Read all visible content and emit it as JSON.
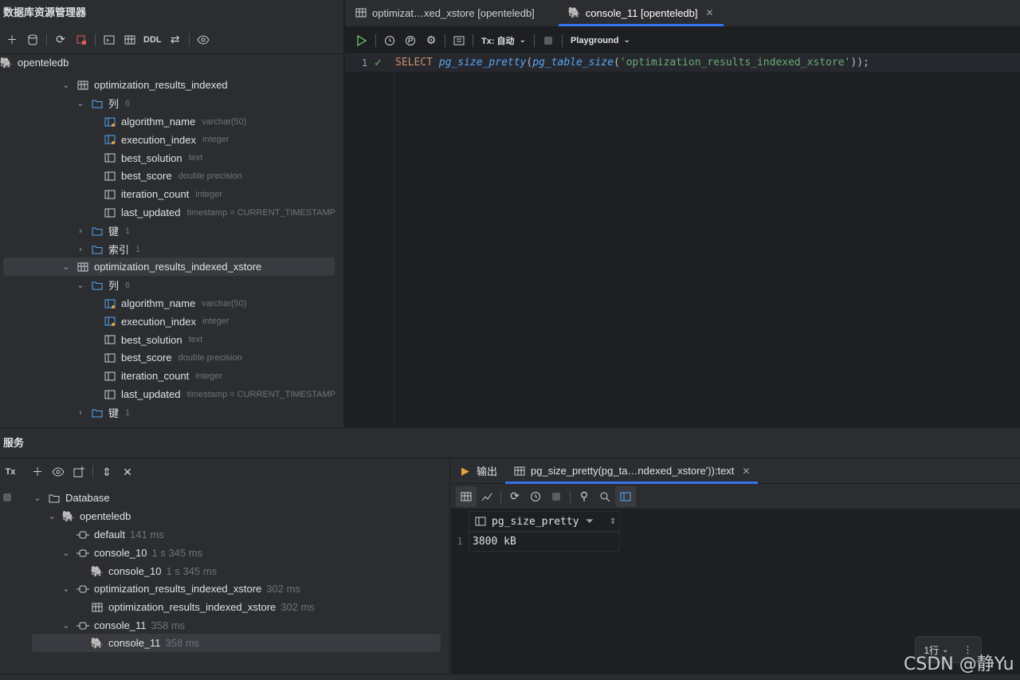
{
  "db_explorer": {
    "title": "数据库资源管理器",
    "toolbar_ddl": "DDL",
    "root": "openteledb",
    "tables": [
      {
        "name": "optimization_results_indexed",
        "columns_label": "列",
        "columns_count": "6",
        "columns": [
          {
            "name": "algorithm_name",
            "type": "varchar(50)"
          },
          {
            "name": "execution_index",
            "type": "integer"
          },
          {
            "name": "best_solution",
            "type": "text"
          },
          {
            "name": "best_score",
            "type": "double precision"
          },
          {
            "name": "iteration_count",
            "type": "integer"
          },
          {
            "name": "last_updated",
            "type": "timestamp = CURRENT_TIMESTAMP"
          }
        ],
        "keys_label": "键",
        "keys_count": "1",
        "indexes_label": "索引",
        "indexes_count": "1"
      },
      {
        "name": "optimization_results_indexed_xstore",
        "columns_label": "列",
        "columns_count": "6",
        "columns": [
          {
            "name": "algorithm_name",
            "type": "varchar(50)"
          },
          {
            "name": "execution_index",
            "type": "integer"
          },
          {
            "name": "best_solution",
            "type": "text"
          },
          {
            "name": "best_score",
            "type": "double precision"
          },
          {
            "name": "iteration_count",
            "type": "integer"
          },
          {
            "name": "last_updated",
            "type": "timestamp = CURRENT_TIMESTAMP"
          }
        ],
        "keys_label": "键",
        "keys_count": "1"
      }
    ]
  },
  "editor": {
    "tabs": [
      {
        "label": "optimizat…xed_xstore [openteledb]"
      },
      {
        "label": "console_11 [openteledb]"
      }
    ],
    "tx_label": "Tx: 自动",
    "playground_label": "Playground",
    "line_number": "1",
    "code": {
      "select": "SELECT",
      "fn1": "pg_size_pretty",
      "open1": "(",
      "fn2": "pg_table_size",
      "open2": "(",
      "str": "'optimization_results_indexed_xstore'",
      "close": "));"
    }
  },
  "services": {
    "title": "服务",
    "tx_label": "Tx",
    "tree": {
      "database": "Database",
      "connection": "openteledb",
      "sessions": [
        {
          "name": "default",
          "time": "141 ms"
        },
        {
          "name": "console_10",
          "time": "1 s 345 ms",
          "child": {
            "name": "console_10",
            "time": "1 s 345 ms"
          }
        },
        {
          "name": "optimization_results_indexed_xstore",
          "time": "302 ms",
          "child": {
            "name": "optimization_results_indexed_xstore",
            "time": "302 ms"
          }
        },
        {
          "name": "console_11",
          "time": "358 ms",
          "child": {
            "name": "console_11",
            "time": "358 ms"
          }
        }
      ]
    }
  },
  "results": {
    "tabs": [
      {
        "label": "输出"
      },
      {
        "label": "pg_size_pretty(pg_ta…ndexed_xstore')):text"
      }
    ],
    "columns": [
      "pg_size_pretty"
    ],
    "rows": [
      {
        "num": "1",
        "value": "3800 kB"
      }
    ],
    "row_count": "1行"
  },
  "watermark": "CSDN @静Yu"
}
